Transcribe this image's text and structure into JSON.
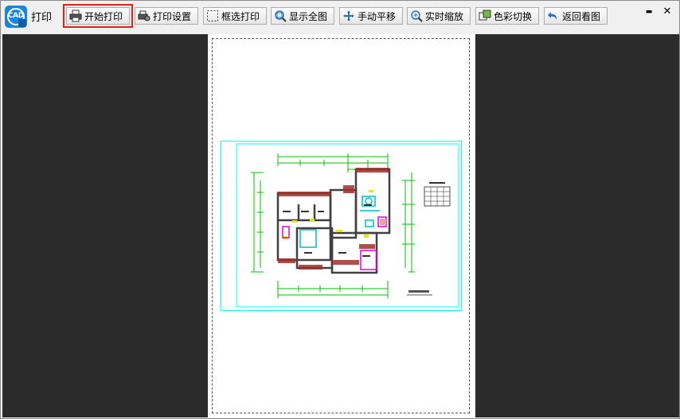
{
  "window": {
    "title": "打印",
    "app_icon_text": "CAD",
    "controls": {
      "minimize": "▬",
      "close": "✕"
    }
  },
  "toolbar": {
    "buttons": [
      {
        "label": "开始打印",
        "icon": "printer-icon",
        "highlighted": true
      },
      {
        "label": "打印设置",
        "icon": "print-settings-icon"
      },
      {
        "label": "框选打印",
        "icon": "dashed-select-icon"
      },
      {
        "label": "显示全图",
        "icon": "show-all-icon"
      },
      {
        "label": "手动平移",
        "icon": "pan-icon"
      },
      {
        "label": "实时缩放",
        "icon": "zoom-icon"
      },
      {
        "label": "色彩切换",
        "icon": "color-switch-icon"
      },
      {
        "label": "返回看图",
        "icon": "back-arrow-icon"
      }
    ]
  },
  "colors": {
    "canvas_background": "#2b2b2b",
    "paper": "#ffffff",
    "highlight_outline": "#e0201b",
    "drawing_frame": "#00ffff",
    "dimension_green": "#00c000",
    "wall_dark": "#404040",
    "hatch_red": "#a0302a"
  }
}
